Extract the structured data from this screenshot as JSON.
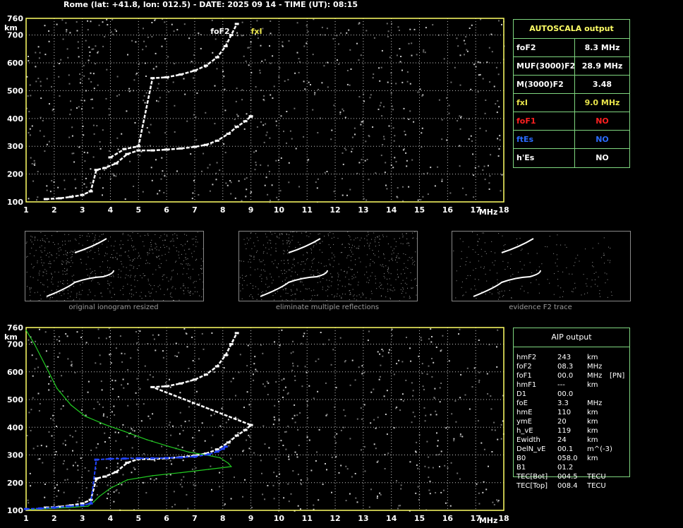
{
  "header": "Rome (lat: +41.8, lon: 012.5) - DATE: 2025 09 14 - TIME (UT): 08:15",
  "axes": {
    "y_unit": "km",
    "x_unit": "MHz",
    "y_ticks": [
      "100",
      "200",
      "300",
      "400",
      "500",
      "600",
      "700",
      "760"
    ],
    "x_ticks": [
      "1",
      "2",
      "3",
      "4",
      "5",
      "6",
      "7",
      "8",
      "9",
      "10",
      "11",
      "12",
      "13",
      "14",
      "15",
      "16",
      "17",
      "18"
    ]
  },
  "marks": {
    "foF2": "foF2",
    "fxI": "fxI"
  },
  "colors": {
    "grid": "#c8c8c8",
    "axis": "#ffff66",
    "green": "#22cc22",
    "blue": "#2244ff",
    "red": "#ff2020",
    "table_border": "#7fd67f"
  },
  "autoscala": {
    "title": "AUTOSCALA output",
    "rows": [
      {
        "label": "foF2",
        "value": "8.3 MHz",
        "color": "#ffffff"
      },
      {
        "label": "MUF(3000)F2",
        "value": "28.9 MHz",
        "color": "#ffffff"
      },
      {
        "label": "M(3000)F2",
        "value": "3.48",
        "color": "#ffffff"
      },
      {
        "label": "fxI",
        "value": "9.0 MHz",
        "color": "#e8e34a"
      },
      {
        "label": "foF1",
        "value": "NO",
        "color": "#ff2020"
      },
      {
        "label": "ftEs",
        "value": "NO",
        "color": "#2a6cff"
      },
      {
        "label": "h'Es",
        "value": "NO",
        "color": "#ffffff"
      }
    ]
  },
  "thumbnails": [
    {
      "caption": "original ionogram resized"
    },
    {
      "caption": "eliminate multiple reflections"
    },
    {
      "caption": "evidence F2 trace"
    }
  ],
  "aip": {
    "title": "AIP output",
    "rows": [
      {
        "name": "hmF2",
        "value": "243",
        "unit": "km",
        "extra": ""
      },
      {
        "name": "foF2",
        "value": "08.3",
        "unit": "MHz",
        "extra": ""
      },
      {
        "name": "foF1",
        "value": "00.0",
        "unit": "MHz",
        "extra": "[PN]"
      },
      {
        "name": "hmF1",
        "value": "---",
        "unit": "km",
        "extra": ""
      },
      {
        "name": "D1",
        "value": "00.0",
        "unit": "",
        "extra": ""
      },
      {
        "name": "foE",
        "value": "3.3",
        "unit": "MHz",
        "extra": ""
      },
      {
        "name": "hmE",
        "value": "110",
        "unit": "km",
        "extra": ""
      },
      {
        "name": "ymE",
        "value": "20",
        "unit": "km",
        "extra": ""
      },
      {
        "name": "h_vE",
        "value": "119",
        "unit": "km",
        "extra": ""
      },
      {
        "name": "Ewidth",
        "value": "24",
        "unit": "km",
        "extra": ""
      },
      {
        "name": "DelN_vE",
        "value": "00.1",
        "unit": "m^(-3)",
        "extra": ""
      },
      {
        "name": "B0",
        "value": "058.0",
        "unit": "km",
        "extra": ""
      },
      {
        "name": "B1",
        "value": "01.2",
        "unit": "",
        "extra": ""
      },
      {
        "name": "TEC[Bot]",
        "value": "004.5",
        "unit": "TECU",
        "extra": ""
      },
      {
        "name": "TEC[Top]",
        "value": "008.4",
        "unit": "TECU",
        "extra": ""
      }
    ]
  },
  "chart_data": [
    {
      "type": "scatter",
      "title": "",
      "xlabel": "MHz",
      "ylabel": "km",
      "xlim": [
        1,
        18
      ],
      "ylim": [
        100,
        760
      ],
      "grid": true,
      "series": [
        {
          "name": "",
          "color": "#ffffff",
          "points": [
            [
              1.7,
              110
            ],
            [
              2.2,
              113
            ],
            [
              2.6,
              118
            ],
            [
              3.0,
              125
            ],
            [
              3.3,
              138
            ],
            [
              3.5,
              215
            ],
            [
              3.8,
              222
            ],
            [
              4.2,
              238
            ],
            [
              4.6,
              272
            ],
            [
              5.0,
              285
            ],
            [
              5.5,
              285
            ],
            [
              6.0,
              288
            ],
            [
              6.5,
              292
            ],
            [
              7.0,
              298
            ],
            [
              7.4,
              305
            ],
            [
              7.8,
              320
            ],
            [
              8.2,
              345
            ],
            [
              8.5,
              370
            ],
            [
              8.8,
              390
            ],
            [
              9.0,
              408
            ]
          ]
        },
        {
          "name": "",
          "color": "#ffffff",
          "points": [
            [
              4.0,
              260
            ],
            [
              4.5,
              290
            ],
            [
              5.0,
              300
            ],
            [
              5.5,
              545
            ],
            [
              6.0,
              548
            ],
            [
              6.5,
              558
            ],
            [
              7.0,
              572
            ],
            [
              7.4,
              590
            ],
            [
              7.8,
              620
            ],
            [
              8.1,
              660
            ],
            [
              8.3,
              700
            ],
            [
              8.5,
              740
            ]
          ]
        }
      ]
    },
    {
      "type": "scatter",
      "title": "",
      "xlabel": "MHz",
      "ylabel": "km",
      "xlim": [
        1,
        18
      ],
      "ylim": [
        100,
        760
      ],
      "grid": true,
      "series": [
        {
          "name": "",
          "color": "#ffffff",
          "points": [
            [
              1.7,
              110
            ],
            [
              2.2,
              113
            ],
            [
              2.6,
              118
            ],
            [
              3.0,
              125
            ],
            [
              3.3,
              138
            ],
            [
              3.5,
              215
            ],
            [
              3.8,
              222
            ],
            [
              4.2,
              238
            ],
            [
              4.6,
              272
            ],
            [
              5.0,
              285
            ],
            [
              5.5,
              285
            ],
            [
              6.0,
              288
            ],
            [
              6.5,
              292
            ],
            [
              7.0,
              298
            ],
            [
              7.4,
              305
            ],
            [
              7.8,
              320
            ],
            [
              8.2,
              345
            ],
            [
              8.5,
              370
            ],
            [
              8.8,
              390
            ],
            [
              9.0,
              408
            ],
            [
              5.5,
              545
            ],
            [
              6.0,
              548
            ],
            [
              6.5,
              558
            ],
            [
              7.0,
              572
            ],
            [
              7.4,
              590
            ],
            [
              7.8,
              620
            ],
            [
              8.1,
              660
            ],
            [
              8.3,
              700
            ],
            [
              8.5,
              740
            ]
          ]
        },
        {
          "name": "",
          "color": "#22cc22",
          "line": true,
          "points": [
            [
              1.0,
              750
            ],
            [
              1.3,
              700
            ],
            [
              1.7,
              620
            ],
            [
              2.1,
              540
            ],
            [
              2.6,
              480
            ],
            [
              3.1,
              440
            ],
            [
              3.8,
              410
            ],
            [
              4.5,
              385
            ],
            [
              5.3,
              355
            ],
            [
              6.1,
              330
            ],
            [
              6.8,
              310
            ],
            [
              7.4,
              300
            ],
            [
              7.9,
              290
            ],
            [
              8.2,
              270
            ],
            [
              8.3,
              258
            ],
            [
              7.5,
              248
            ],
            [
              6.5,
              236
            ],
            [
              5.5,
              225
            ],
            [
              4.6,
              210
            ],
            [
              4.0,
              180
            ],
            [
              3.6,
              150
            ],
            [
              3.4,
              130
            ],
            [
              3.2,
              115
            ],
            [
              2.5,
              110
            ],
            [
              1.5,
              105
            ],
            [
              1.0,
              103
            ]
          ]
        },
        {
          "name": "",
          "color": "#2244ff",
          "points": [
            [
              1.0,
              105
            ],
            [
              1.5,
              107
            ],
            [
              2.0,
              110
            ],
            [
              2.5,
              114
            ],
            [
              3.0,
              118
            ],
            [
              3.3,
              125
            ],
            [
              3.5,
              283
            ],
            [
              4.0,
              286
            ],
            [
              4.5,
              287
            ],
            [
              5.0,
              288
            ],
            [
              5.5,
              288
            ],
            [
              6.0,
              289
            ],
            [
              6.5,
              291
            ],
            [
              7.0,
              294
            ],
            [
              7.5,
              302
            ],
            [
              7.8,
              312
            ],
            [
              8.0,
              322
            ],
            [
              8.1,
              330
            ]
          ]
        }
      ]
    }
  ]
}
